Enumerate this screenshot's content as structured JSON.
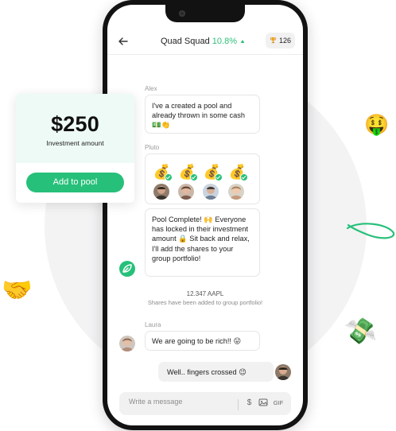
{
  "header": {
    "title": "Quad Squad",
    "performance": "10.8%",
    "performance_icon": "up-triangle-icon",
    "trophy_icon": "trophy-icon",
    "trophy_count": "126"
  },
  "messages": {
    "alex": {
      "sender": "Alex",
      "text": "I've a created a pool and already thrown in some cash 💵👏"
    },
    "pluto": {
      "sender": "Pluto",
      "pool_status_icons": [
        "money-bag-icon",
        "money-bag-icon",
        "money-bag-icon",
        "money-bag-icon"
      ],
      "avatars": [
        "avatar-1",
        "avatar-2",
        "avatar-3",
        "avatar-4"
      ],
      "text": "Pool Complete! 🙌 Everyone has locked in their investment amount 🔒 Sit back and relax, I'll add the shares to your group portfolio!"
    },
    "system": {
      "title": "12.347 AAPL",
      "subtitle": "Shares have been added to group portfolio!"
    },
    "laura": {
      "sender": "Laura",
      "text": "We are going to be rich!! 😛"
    },
    "self": {
      "text": "Well.. fingers crossed 😉"
    }
  },
  "composer": {
    "placeholder": "Write a message",
    "gif_label": "GIF"
  },
  "investment_card": {
    "amount": "$250",
    "label": "Investment amount",
    "button_label": "Add to pool"
  },
  "colors": {
    "accent": "#27c07a",
    "success_text": "#2fbf7a",
    "phone_frame": "#121212",
    "card_tint": "#eefaf5"
  }
}
